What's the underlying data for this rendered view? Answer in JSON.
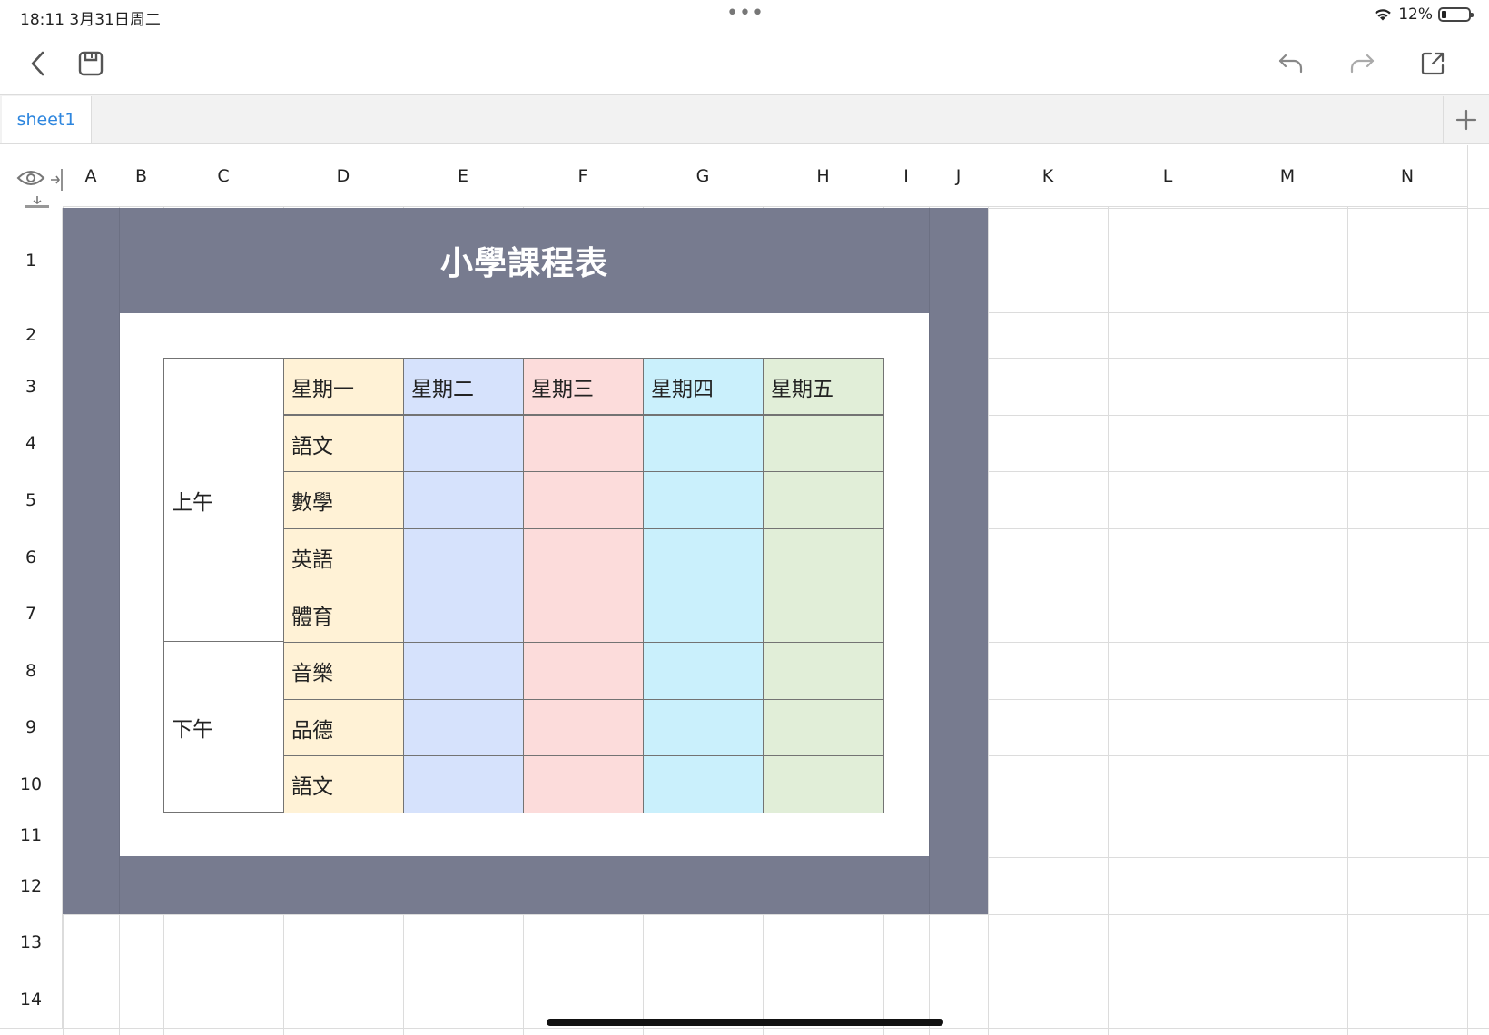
{
  "status_bar": {
    "time_date": "18:11  3月31日周二",
    "dots": "•••",
    "battery_percent": "12%",
    "battery_level": 0.12
  },
  "toolbar": {
    "back_icon": "chevron-left-icon",
    "save_icon": "floppy-disk-icon",
    "undo_icon": "undo-icon",
    "redo_icon": "redo-icon",
    "share_icon": "share-export-icon"
  },
  "sheet_tabs": {
    "tabs": [
      "sheet1"
    ],
    "add_label": "+"
  },
  "grid": {
    "column_headers": [
      "A",
      "B",
      "C",
      "D",
      "E",
      "F",
      "G",
      "H",
      "I",
      "J",
      "K",
      "L",
      "M",
      "N"
    ],
    "row_headers": [
      "1",
      "2",
      "3",
      "4",
      "5",
      "6",
      "7",
      "8",
      "9",
      "10",
      "11",
      "12",
      "13",
      "14"
    ]
  },
  "schedule": {
    "title": "小學課程表",
    "periods": [
      "上午",
      "下午"
    ],
    "days": [
      "星期一",
      "星期二",
      "星期三",
      "星期四",
      "星期五"
    ],
    "monday_subjects": [
      "語文",
      "數學",
      "英語",
      "體育",
      "音樂",
      "品德",
      "語文"
    ],
    "colors": {
      "frame": "#777b8f",
      "monday": "#fff2d6",
      "tuesday": "#d6e2fc",
      "wednesday": "#fcdcdb",
      "thursday": "#caf0fc",
      "friday": "#e1eed8"
    }
  }
}
